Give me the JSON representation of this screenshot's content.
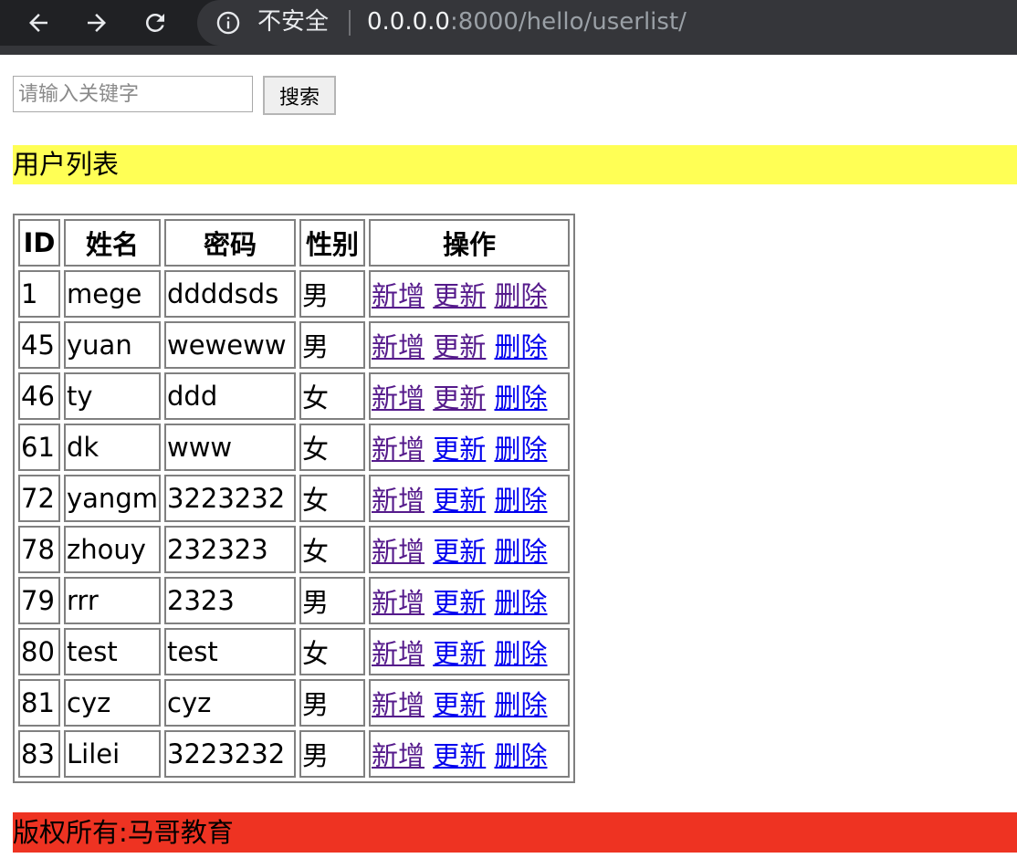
{
  "browser": {
    "insecure_label": "不安全",
    "url_host": "0.0.0.0",
    "url_rest": ":8000/hello/userlist/",
    "icons": [
      "back-arrow-icon",
      "forward-arrow-icon",
      "reload-icon",
      "info-icon"
    ]
  },
  "search": {
    "placeholder": "请输入关键字",
    "button_label": "搜索"
  },
  "title": "用户列表",
  "table": {
    "headers": [
      "ID",
      "姓名",
      "密码",
      "性别",
      "操作"
    ],
    "rows": [
      {
        "id": "1",
        "name": "mege",
        "password": "ddddsds",
        "sex": "男",
        "actions": [
          "新增",
          "更新",
          "删除"
        ],
        "visited": [
          true,
          true,
          true
        ]
      },
      {
        "id": "45",
        "name": "yuan",
        "password": "weweww",
        "sex": "男",
        "actions": [
          "新增",
          "更新",
          "删除"
        ],
        "visited": [
          true,
          true,
          false
        ]
      },
      {
        "id": "46",
        "name": "ty",
        "password": "ddd",
        "sex": "女",
        "actions": [
          "新增",
          "更新",
          "删除"
        ],
        "visited": [
          true,
          true,
          false
        ]
      },
      {
        "id": "61",
        "name": "dk",
        "password": "www",
        "sex": "女",
        "actions": [
          "新增",
          "更新",
          "删除"
        ],
        "visited": [
          true,
          false,
          false
        ]
      },
      {
        "id": "72",
        "name": "yangm",
        "password": "3223232",
        "sex": "女",
        "actions": [
          "新增",
          "更新",
          "删除"
        ],
        "visited": [
          true,
          false,
          false
        ]
      },
      {
        "id": "78",
        "name": "zhouy",
        "password": "232323",
        "sex": "女",
        "actions": [
          "新增",
          "更新",
          "删除"
        ],
        "visited": [
          true,
          false,
          false
        ]
      },
      {
        "id": "79",
        "name": "rrr",
        "password": "2323",
        "sex": "男",
        "actions": [
          "新增",
          "更新",
          "删除"
        ],
        "visited": [
          true,
          false,
          false
        ]
      },
      {
        "id": "80",
        "name": "test",
        "password": "test",
        "sex": "女",
        "actions": [
          "新增",
          "更新",
          "删除"
        ],
        "visited": [
          true,
          false,
          false
        ]
      },
      {
        "id": "81",
        "name": "cyz",
        "password": "cyz",
        "sex": "男",
        "actions": [
          "新增",
          "更新",
          "删除"
        ],
        "visited": [
          true,
          false,
          false
        ]
      },
      {
        "id": "83",
        "name": "Lilei",
        "password": "3223232",
        "sex": "男",
        "actions": [
          "新增",
          "更新",
          "删除"
        ],
        "visited": [
          true,
          false,
          false
        ]
      }
    ]
  },
  "footer": "版权所有:马哥教育",
  "colors": {
    "title_bg": "#ffff55",
    "footer_bg": "#ee3322",
    "link": "#0000ee",
    "link_visited": "#551a8b"
  }
}
